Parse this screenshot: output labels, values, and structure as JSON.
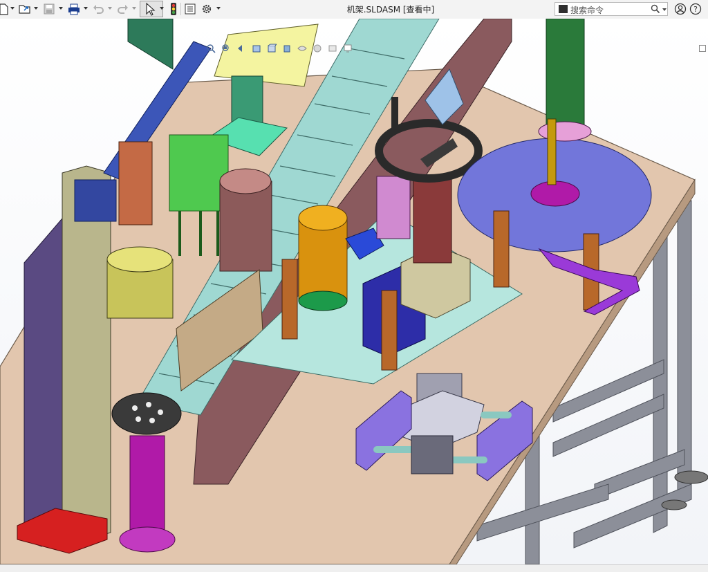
{
  "window": {
    "document_title": "机架.SLDASM [查看中]"
  },
  "toolbar": {
    "items": [
      {
        "name": "new-document",
        "icon": "new-document-icon"
      },
      {
        "name": "open",
        "icon": "open-folder-icon"
      },
      {
        "name": "save",
        "icon": "save-icon"
      },
      {
        "name": "print",
        "icon": "print-icon"
      },
      {
        "name": "undo",
        "icon": "undo-icon"
      },
      {
        "name": "redo",
        "icon": "redo-icon"
      },
      {
        "name": "select",
        "icon": "select-arrow-icon"
      },
      {
        "name": "rebuild",
        "icon": "traffic-light-icon"
      },
      {
        "name": "file-properties",
        "icon": "file-properties-icon"
      },
      {
        "name": "options",
        "icon": "gear-icon"
      }
    ]
  },
  "search": {
    "placeholder": "搜索命令"
  },
  "heads_up_toolbar": {
    "items": [
      "zoom-to-fit-icon",
      "zoom-area-icon",
      "previous-view-icon",
      "section-view-icon",
      "view-orientation-icon",
      "display-style-icon",
      "hide-show-icon",
      "edit-appearance-icon",
      "apply-scene-icon",
      "view-settings-icon",
      "display-pane-icon"
    ]
  },
  "colors": {
    "toolbar_bg": "#f3f3f3",
    "table_top": "#e2c6ae",
    "frame": "#8c8f99",
    "disk": "#7276da",
    "accent_red": "#d62020"
  }
}
